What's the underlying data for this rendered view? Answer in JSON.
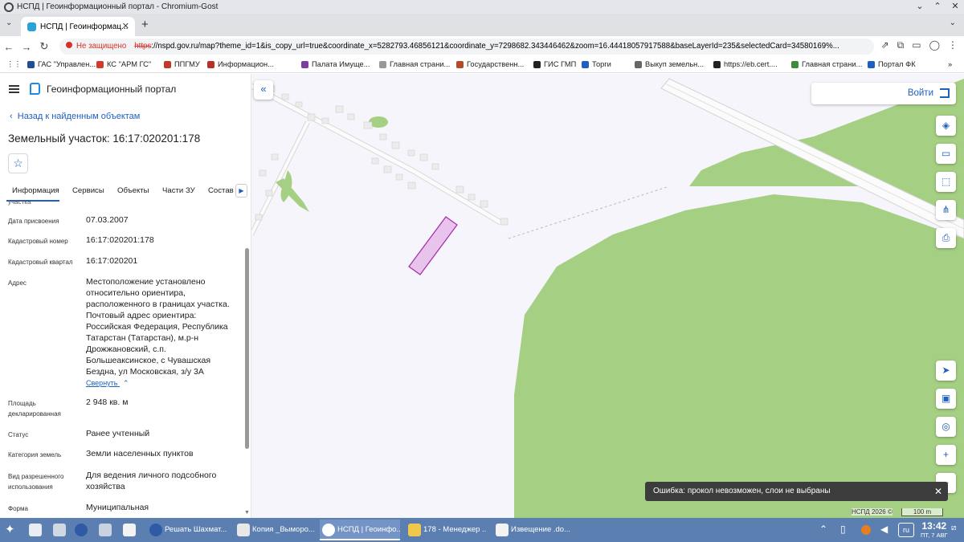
{
  "window": {
    "title": "НСПД | Геоинформационный портал - Chromium-Gost"
  },
  "browser": {
    "tab_title": "НСПД | Геоинформац...",
    "security_label": "Не защищено",
    "url_scheme": "https",
    "url_rest": "://nspd.gov.ru/map?theme_id=1&is_copy_url=true&coordinate_x=5282793.46856121&coordinate_y=7298682.343446462&zoom=16.44418057917588&baseLayerId=235&selectedCard=34580169%..."
  },
  "bookmarks": [
    {
      "label": "ГАС \"Управлен...",
      "color": "#1f4e96"
    },
    {
      "label": "КС \"АРМ ГС\"",
      "color": "#d33a2c"
    },
    {
      "label": "ППГМУ",
      "color": "#c0392b"
    },
    {
      "label": "Информацион...",
      "color": "#b7312c"
    },
    {
      "label": "",
      "color": "#222222"
    },
    {
      "label": "Палата Имуще...",
      "color": "#7b3fa0"
    },
    {
      "label": "Главная страни...",
      "color": "#999999"
    },
    {
      "label": "Государственн...",
      "color": "#b34a2a"
    },
    {
      "label": "ГИС ГМП",
      "color": "#222222"
    },
    {
      "label": "Торги",
      "color": "#1e5fbf"
    },
    {
      "label": "",
      "color": "#222222"
    },
    {
      "label": "Выкуп земельн...",
      "color": "#666666"
    },
    {
      "label": "https://eb.cert....",
      "color": "#222222"
    },
    {
      "label": "Главная страни...",
      "color": "#3b8d3b"
    },
    {
      "label": "",
      "color": "#222222"
    },
    {
      "label": "Портал ФК",
      "color": "#1e5fbf"
    }
  ],
  "portal": {
    "title": "Геоинформационный портал",
    "back_link": "Назад к найденным объектам",
    "parcel_title": "Земельный участок: 16:17:020201:178",
    "tabs": [
      "Информация",
      "Сервисы",
      "Объекты",
      "Части ЗУ",
      "Состав"
    ],
    "cut_label": "участка",
    "fields": [
      {
        "label": "Дата присвоения",
        "value": "07.03.2007"
      },
      {
        "label": "Кадастровый номер",
        "value": "16:17:020201:178"
      },
      {
        "label": "Кадастровый квартал",
        "value": "16:17:020201"
      },
      {
        "label": "Адрес",
        "value": "Местоположение установлено относительно ориентира, расположенного в границах участка. Почтовый адрес ориентира: Российская Федерация, Республика Татарстан (Татарстан), м.р-н Дрожжановский, с.п. Большеаксинское, с Чувашская Бездна, ул Московская, з/у 3А"
      },
      {
        "label": "Площадь декларированная",
        "value": "2 948 кв. м"
      },
      {
        "label": "Статус",
        "value": "Ранее учтенный"
      },
      {
        "label": "Категория земель",
        "value": "Земли населенных пунктов"
      },
      {
        "label": "Вид разрешенного использования",
        "value": "Для ведения личного подсобного хозяйства"
      },
      {
        "label": "Форма",
        "value": "Муниципальная"
      }
    ],
    "collapse_link": "Свернуть"
  },
  "map": {
    "login_label": "Войти",
    "error_toast": "Ошибка: прокол невозможен, слои не выбраны",
    "copyright": "НСПД 2026 ©",
    "scale_label": "100 m",
    "colors": {
      "green": "#a5cf82",
      "parcel": "#e8c4ec",
      "parcel_border": "#a52aaa"
    }
  },
  "taskbar": {
    "tasks": [
      "Решать Шахмат...",
      "Копия _Выморо...",
      "НСПД | Геоинфо...",
      "178 - Менеджер ...",
      "Извещение .do..."
    ],
    "lang": "ru",
    "time": "13:42",
    "date": "ПТ, 7 АВГ"
  }
}
